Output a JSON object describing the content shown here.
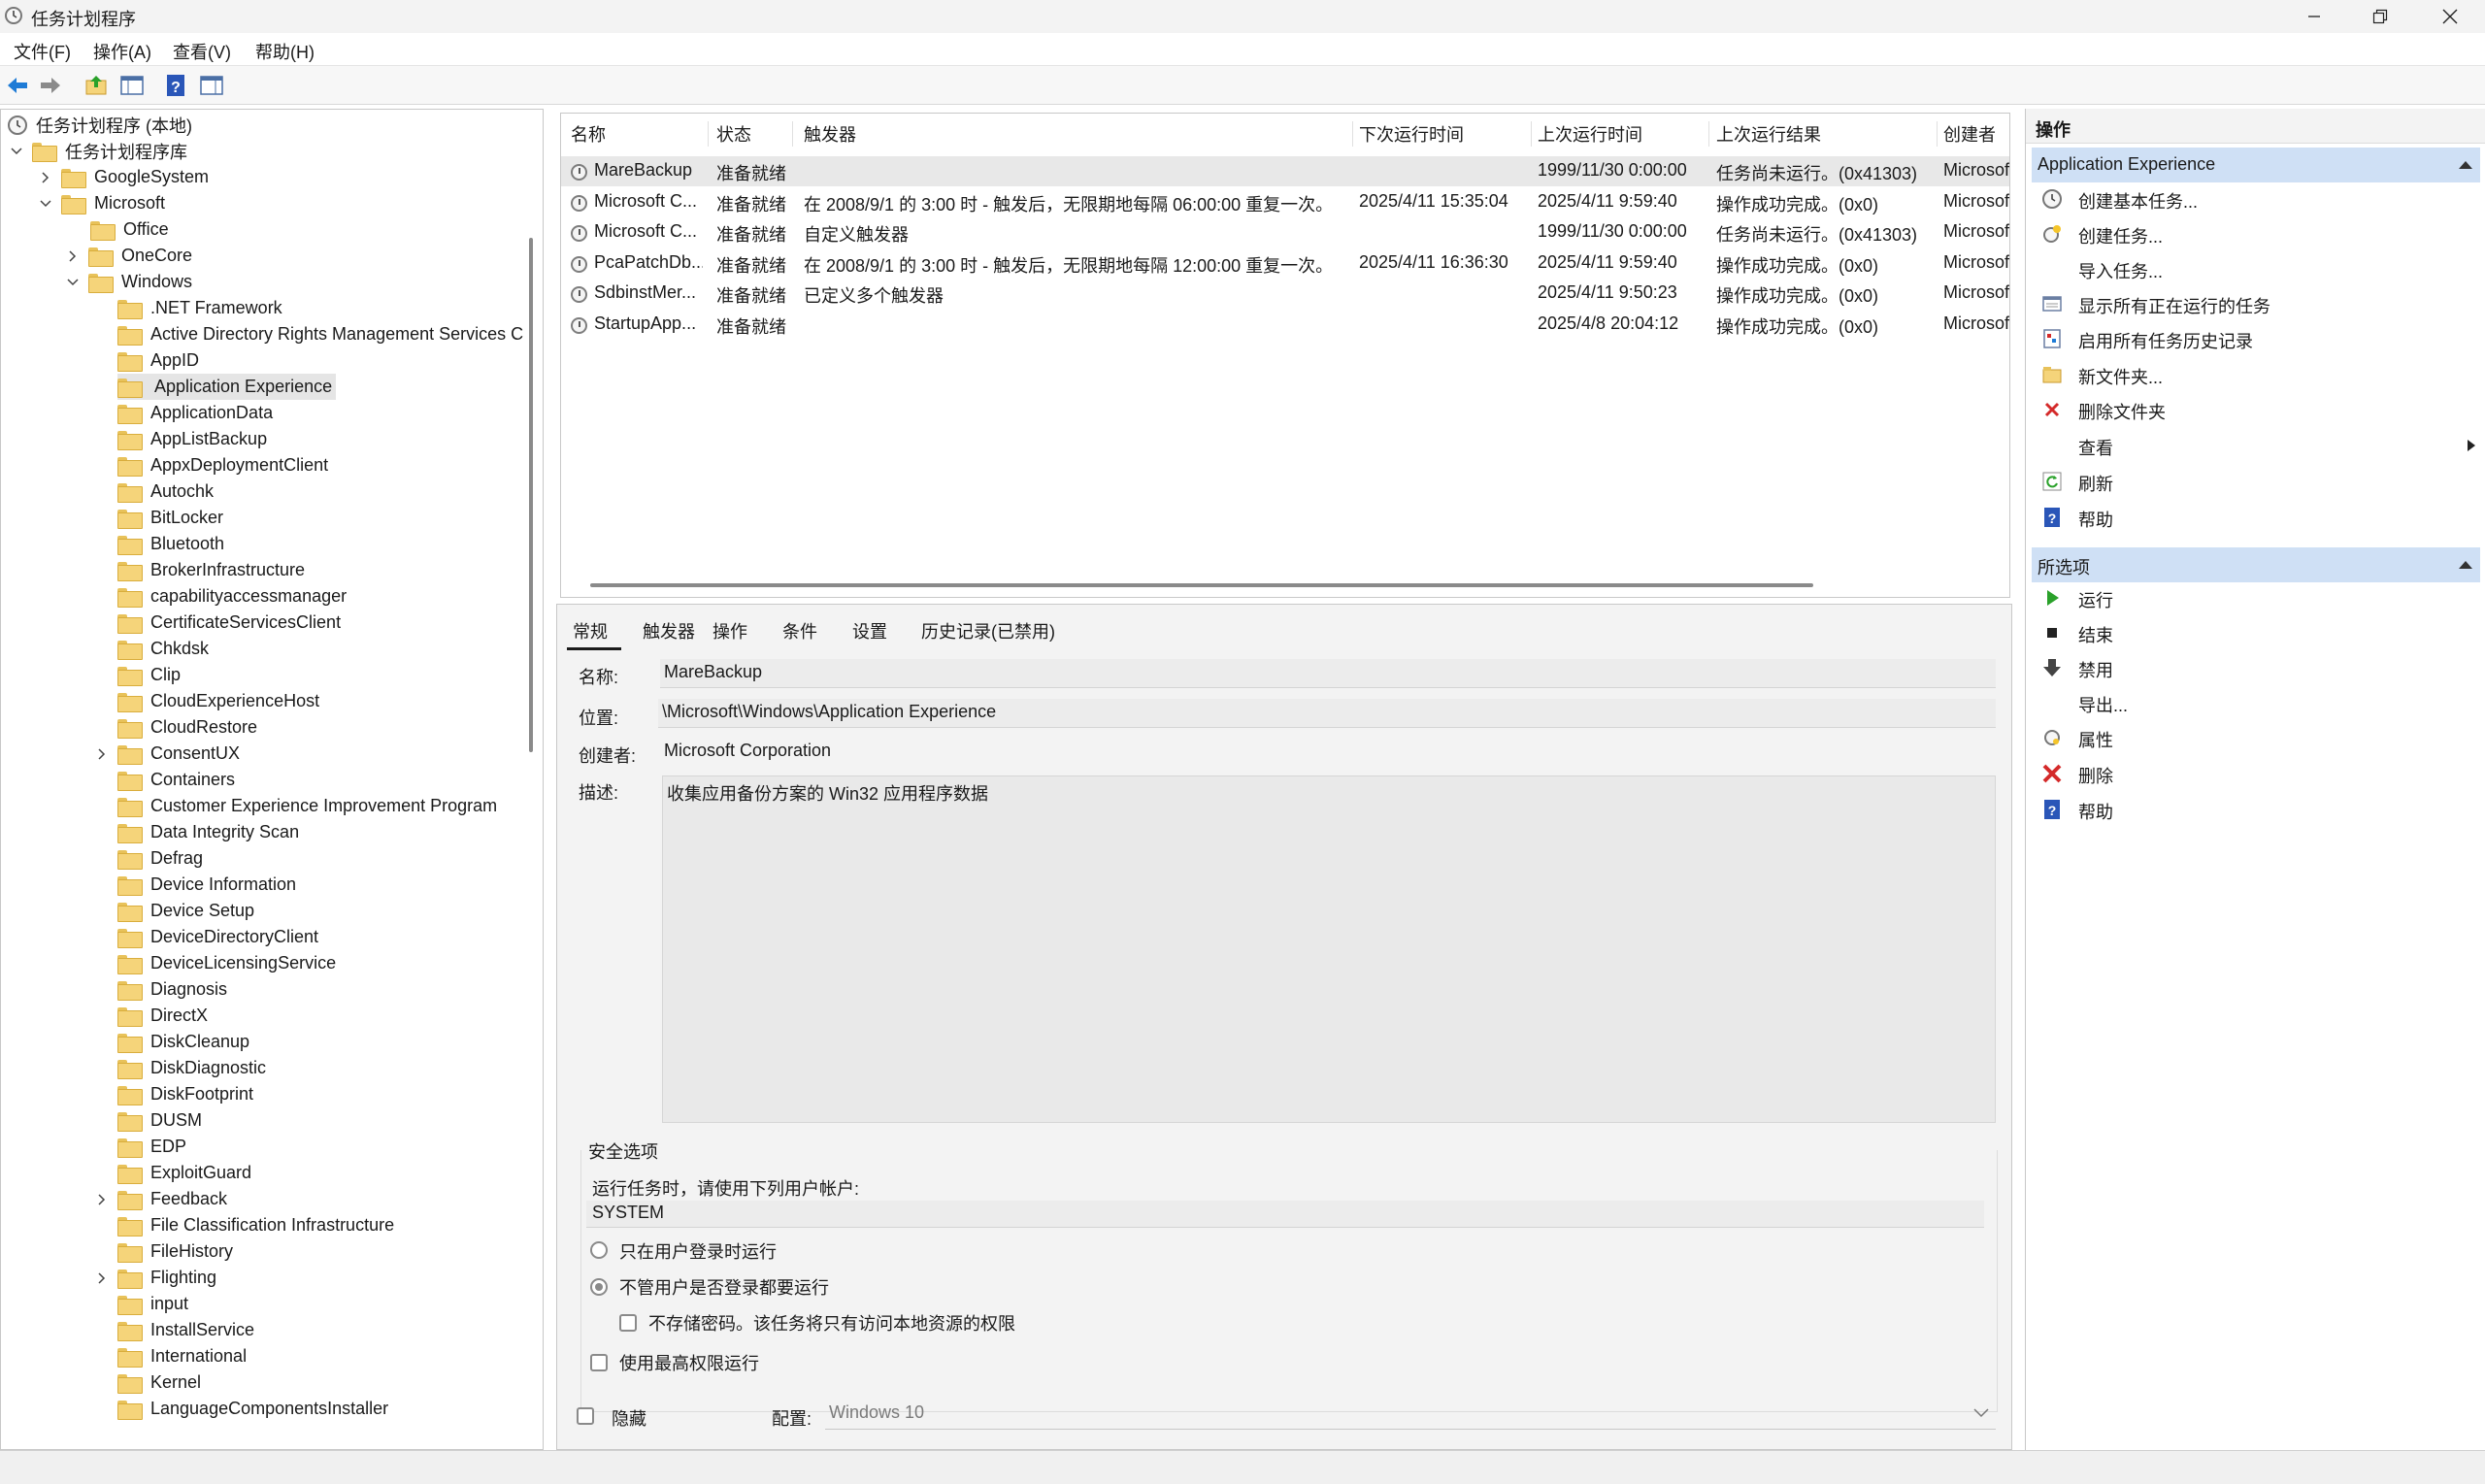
{
  "window": {
    "title": "任务计划程序"
  },
  "menu": [
    "文件(F)",
    "操作(A)",
    "查看(V)",
    "帮助(H)"
  ],
  "tree": {
    "root": "任务计划程序 (本地)",
    "library": "任务计划程序库",
    "google": "GoogleSystem",
    "microsoft": "Microsoft",
    "office": "Office",
    "onecore": "OneCore",
    "windows": "Windows",
    "windows_children": [
      ".NET Framework",
      "Active Directory Rights Management Services C",
      "AppID",
      "Application Experience",
      "ApplicationData",
      "AppListBackup",
      "AppxDeploymentClient",
      "Autochk",
      "BitLocker",
      "Bluetooth",
      "BrokerInfrastructure",
      "capabilityaccessmanager",
      "CertificateServicesClient",
      "Chkdsk",
      "Clip",
      "CloudExperienceHost",
      "CloudRestore",
      "ConsentUX",
      "Containers",
      "Customer Experience Improvement Program",
      "Data Integrity Scan",
      "Defrag",
      "Device Information",
      "Device Setup",
      "DeviceDirectoryClient",
      "DeviceLicensingService",
      "Diagnosis",
      "DirectX",
      "DiskCleanup",
      "DiskDiagnostic",
      "DiskFootprint",
      "DUSM",
      "EDP",
      "ExploitGuard",
      "Feedback",
      "File Classification Infrastructure",
      "FileHistory",
      "Flighting",
      "input",
      "InstallService",
      "International",
      "Kernel",
      "LanguageComponentsInstaller"
    ]
  },
  "tasklist": {
    "headers": [
      "名称",
      "状态",
      "触发器",
      "下次运行时间",
      "上次运行时间",
      "上次运行结果",
      "创建者"
    ],
    "rows": [
      [
        "MareBackup",
        "准备就绪",
        "",
        "",
        "1999/11/30 0:00:00",
        "任务尚未运行。(0x41303)",
        "Microsof"
      ],
      [
        "Microsoft C...",
        "准备就绪",
        "在 2008/9/1 的 3:00 时 - 触发后，无限期地每隔 06:00:00 重复一次。",
        "2025/4/11 15:35:04",
        "2025/4/11 9:59:40",
        "操作成功完成。(0x0)",
        "Microsof"
      ],
      [
        "Microsoft C...",
        "准备就绪",
        "自定义触发器",
        "",
        "1999/11/30 0:00:00",
        "任务尚未运行。(0x41303)",
        "Microsof"
      ],
      [
        "PcaPatchDb...",
        "准备就绪",
        "在 2008/9/1 的 3:00 时 - 触发后，无限期地每隔 12:00:00 重复一次。",
        "2025/4/11 16:36:30",
        "2025/4/11 9:59:40",
        "操作成功完成。(0x0)",
        "Microsof"
      ],
      [
        "SdbinstMer...",
        "准备就绪",
        "已定义多个触发器",
        "",
        "2025/4/11 9:50:23",
        "操作成功完成。(0x0)",
        "Microsof"
      ],
      [
        "StartupApp...",
        "准备就绪",
        "",
        "",
        "2025/4/8 20:04:12",
        "操作成功完成。(0x0)",
        "Microsof"
      ]
    ]
  },
  "detail": {
    "tabs": [
      "常规",
      "触发器",
      "操作",
      "条件",
      "设置",
      "历史记录(已禁用)"
    ],
    "name_label": "名称:",
    "name_value": "MareBackup",
    "location_label": "位置:",
    "location_value": "\\Microsoft\\Windows\\Application Experience",
    "author_label": "创建者:",
    "author_value": "Microsoft Corporation",
    "desc_label": "描述:",
    "desc_value": "收集应用备份方案的 Win32 应用程序数据",
    "security_title": "安全选项",
    "run_as_label": "运行任务时，请使用下列用户帐户:",
    "run_as_value": "SYSTEM",
    "opt_logged_on": "只在用户登录时运行",
    "opt_whether": "不管用户是否登录都要运行",
    "opt_no_password": "不存储密码。该任务将只有访问本地资源的权限",
    "opt_highest": "使用最高权限运行",
    "hidden_label": "隐藏",
    "config_label": "配置:",
    "config_value": "Windows 10"
  },
  "actions": {
    "header": "操作",
    "section1": "Application Experience",
    "section1_items": [
      "创建基本任务...",
      "创建任务...",
      "导入任务...",
      "显示所有正在运行的任务",
      "启用所有任务历史记录",
      "新文件夹...",
      "删除文件夹",
      "查看",
      "刷新",
      "帮助"
    ],
    "section2": "所选项",
    "section2_items": [
      "运行",
      "结束",
      "禁用",
      "导出...",
      "属性",
      "删除",
      "帮助"
    ]
  },
  "colors": {
    "selection": "#cfe0f5",
    "accent_blue": "#1e7bd6",
    "delete_red": "#d42a2a",
    "run_green": "#2aa12a"
  }
}
